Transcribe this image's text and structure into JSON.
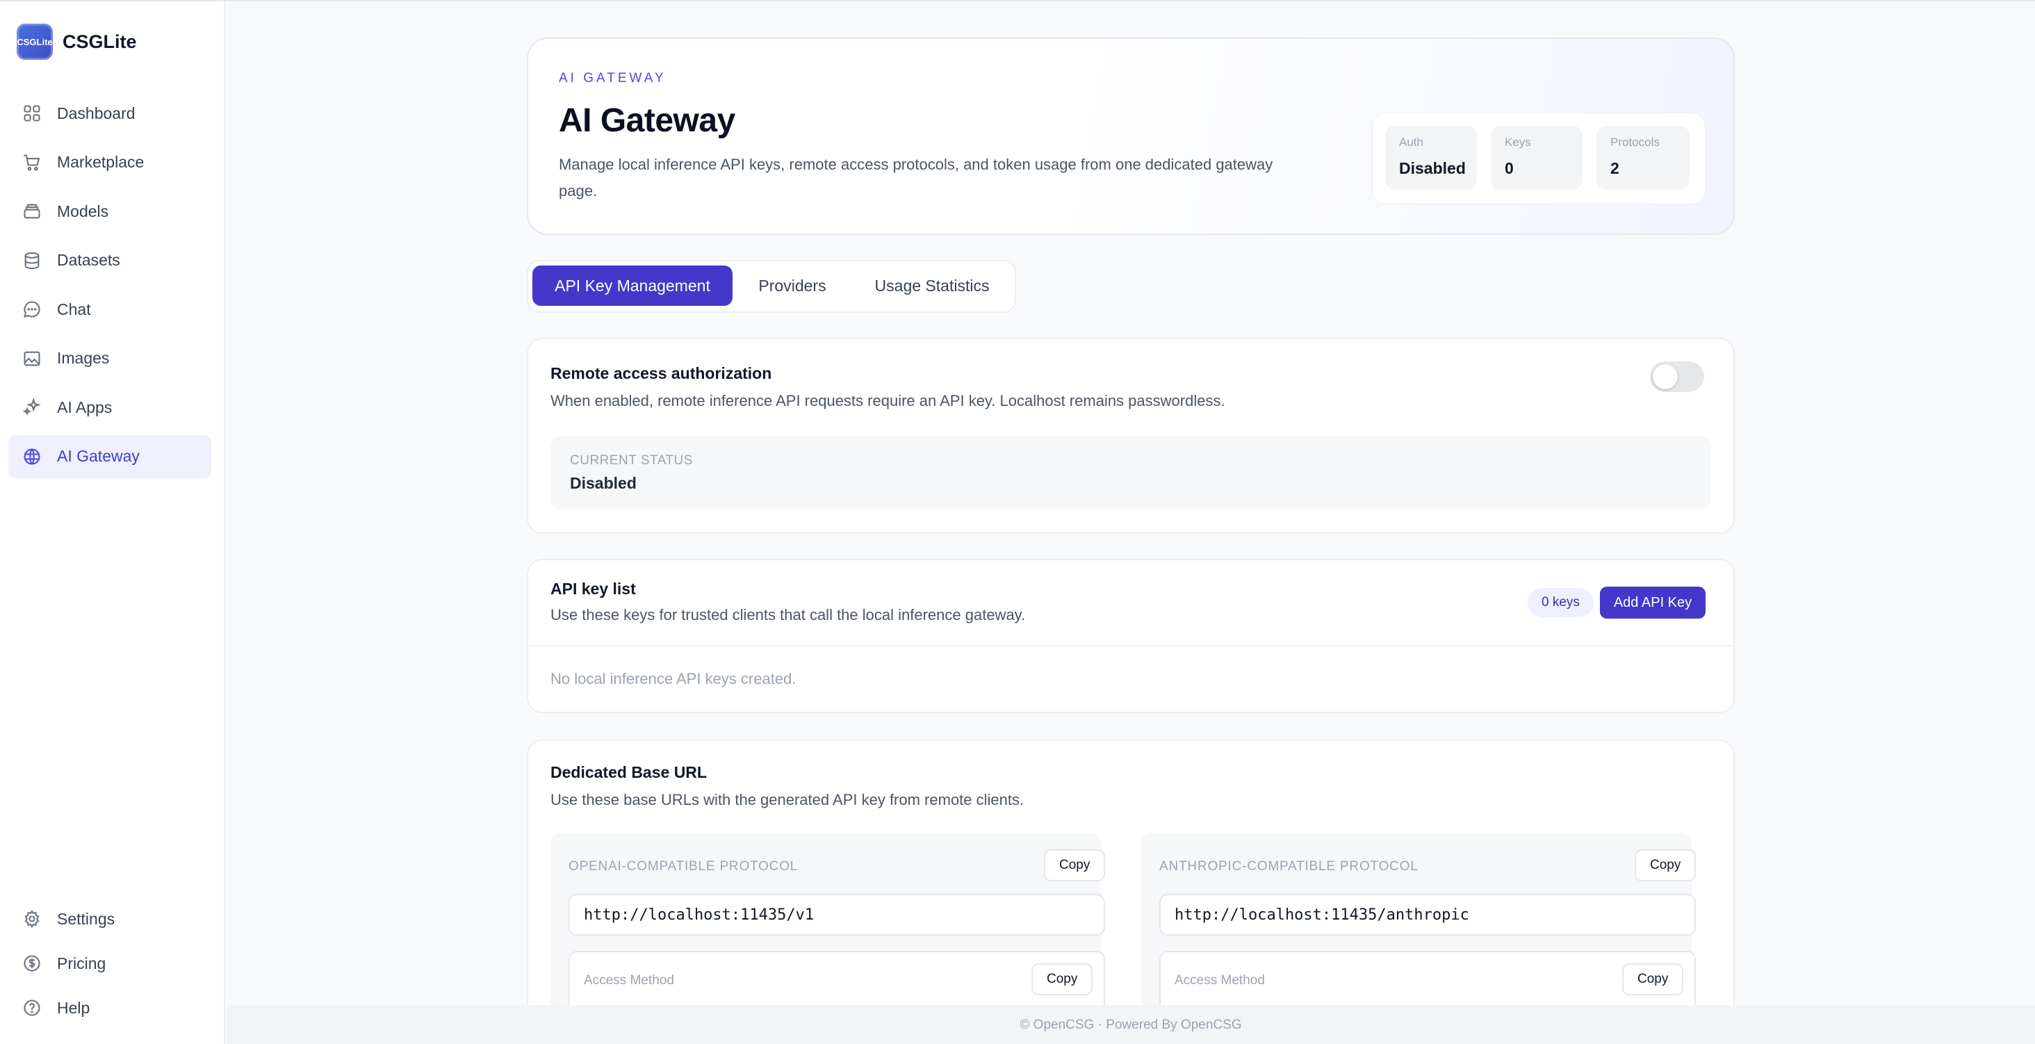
{
  "app": {
    "name": "CSGLite",
    "logo_text": "CSGLite"
  },
  "sidebar": {
    "items": [
      {
        "label": "Dashboard",
        "icon": "grid-icon"
      },
      {
        "label": "Marketplace",
        "icon": "cart-icon"
      },
      {
        "label": "Models",
        "icon": "box-icon"
      },
      {
        "label": "Datasets",
        "icon": "database-icon"
      },
      {
        "label": "Chat",
        "icon": "chat-bubble-icon"
      },
      {
        "label": "Images",
        "icon": "image-icon"
      },
      {
        "label": "AI Apps",
        "icon": "sparkles-icon"
      },
      {
        "label": "AI Gateway",
        "icon": "gateway-icon",
        "active": true
      }
    ],
    "bottom_items": [
      {
        "label": "Settings",
        "icon": "gear-icon"
      },
      {
        "label": "Pricing",
        "icon": "dollar-circle-icon"
      },
      {
        "label": "Help",
        "icon": "help-circle-icon"
      }
    ]
  },
  "hero": {
    "eyebrow": "AI GATEWAY",
    "title": "AI Gateway",
    "description": "Manage local inference API keys, remote access protocols, and token usage from one dedicated gateway page.",
    "stats": [
      {
        "label": "Auth",
        "value": "Disabled"
      },
      {
        "label": "Keys",
        "value": "0"
      },
      {
        "label": "Protocols",
        "value": "2"
      }
    ]
  },
  "tabs": [
    {
      "label": "API Key Management",
      "active": true
    },
    {
      "label": "Providers"
    },
    {
      "label": "Usage Statistics"
    }
  ],
  "remote_access": {
    "title": "Remote access authorization",
    "description": "When enabled, remote inference API requests require an API key. Localhost remains passwordless.",
    "toggle_enabled": false,
    "status_label": "CURRENT STATUS",
    "status_value": "Disabled"
  },
  "api_keys": {
    "title": "API key list",
    "description": "Use these keys for trusted clients that call the local inference gateway.",
    "count_badge": "0 keys",
    "add_button": "Add API Key",
    "empty_text": "No local inference API keys created."
  },
  "base_url": {
    "title": "Dedicated Base URL",
    "description": "Use these base URLs with the generated API key from remote clients.",
    "protocols": [
      {
        "label": "OPENAI-COMPATIBLE PROTOCOL",
        "url": "http://localhost:11435/v1",
        "copy_label": "Copy",
        "access_label": "Access Method",
        "access_copy_label": "Copy"
      },
      {
        "label": "ANTHROPIC-COMPATIBLE PROTOCOL",
        "url": "http://localhost:11435/anthropic",
        "copy_label": "Copy",
        "access_label": "Access Method",
        "access_copy_label": "Copy"
      }
    ]
  },
  "footer": {
    "text": "© OpenCSG · Powered By OpenCSG"
  },
  "colors": {
    "accent": "#4338ca",
    "active_nav_bg": "#eef0fd",
    "page_bg": "#f8f9fb"
  }
}
